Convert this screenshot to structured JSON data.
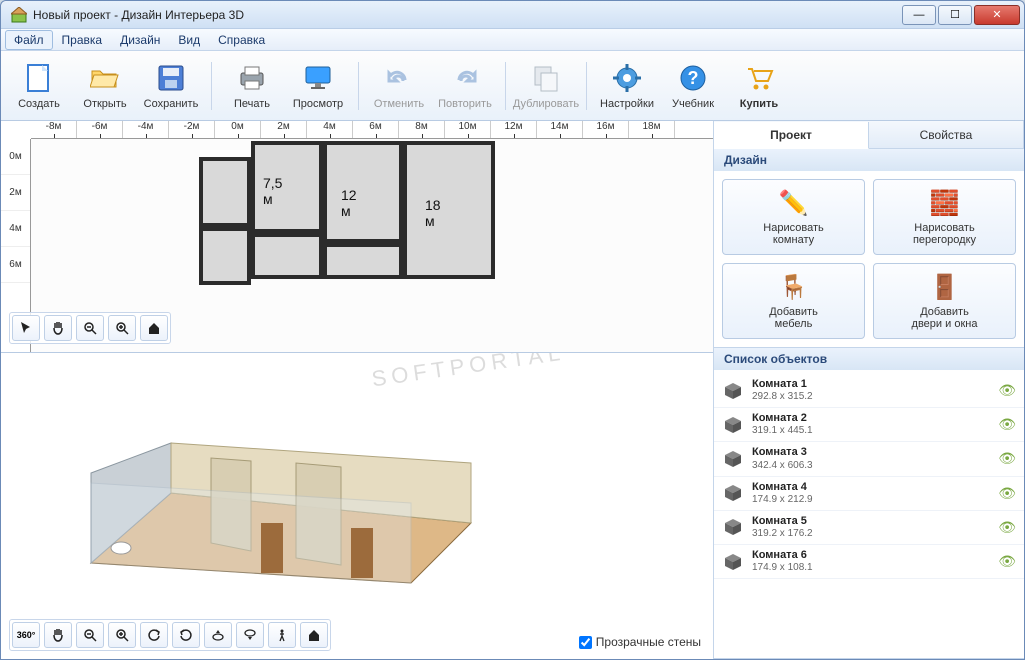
{
  "window": {
    "title": "Новый проект - Дизайн Интерьера 3D"
  },
  "menu": {
    "items": [
      "Файл",
      "Правка",
      "Дизайн",
      "Вид",
      "Справка"
    ],
    "selected": 0
  },
  "toolbar": {
    "create": "Создать",
    "open": "Открыть",
    "save": "Сохранить",
    "print": "Печать",
    "preview": "Просмотр",
    "undo": "Отменить",
    "redo": "Повторить",
    "duplicate": "Дублировать",
    "settings": "Настройки",
    "tutorial": "Учебник",
    "buy": "Купить"
  },
  "ruler": {
    "h": [
      "-8м",
      "-6м",
      "-4м",
      "-2м",
      "0м",
      "2м",
      "4м",
      "6м",
      "8м",
      "10м",
      "12м",
      "14м",
      "16м",
      "18м"
    ],
    "v": [
      "0м",
      "2м",
      "4м",
      "6м"
    ]
  },
  "floorplan": {
    "labels": {
      "r1": "7,5 м",
      "r2": "12 м",
      "r3": "18 м"
    }
  },
  "checkbox": {
    "transparent_walls": "Прозрачные стены"
  },
  "tabs": {
    "project": "Проект",
    "properties": "Свойства"
  },
  "design": {
    "header": "Дизайн",
    "draw_room": "Нарисовать\nкомнату",
    "draw_partition": "Нарисовать\nперегородку",
    "add_furniture": "Добавить\nмебель",
    "add_doors": "Добавить\nдвери и окна"
  },
  "objects": {
    "header": "Список объектов",
    "items": [
      {
        "name": "Комната 1",
        "dim": "292.8 x 315.2"
      },
      {
        "name": "Комната 2",
        "dim": "319.1 x 445.1"
      },
      {
        "name": "Комната 3",
        "dim": "342.4 x 606.3"
      },
      {
        "name": "Комната 4",
        "dim": "174.9 x 212.9"
      },
      {
        "name": "Комната 5",
        "dim": "319.2 x 176.2"
      },
      {
        "name": "Комната 6",
        "dim": "174.9 x 108.1"
      }
    ]
  },
  "watermark": "SOFTPORTAL"
}
